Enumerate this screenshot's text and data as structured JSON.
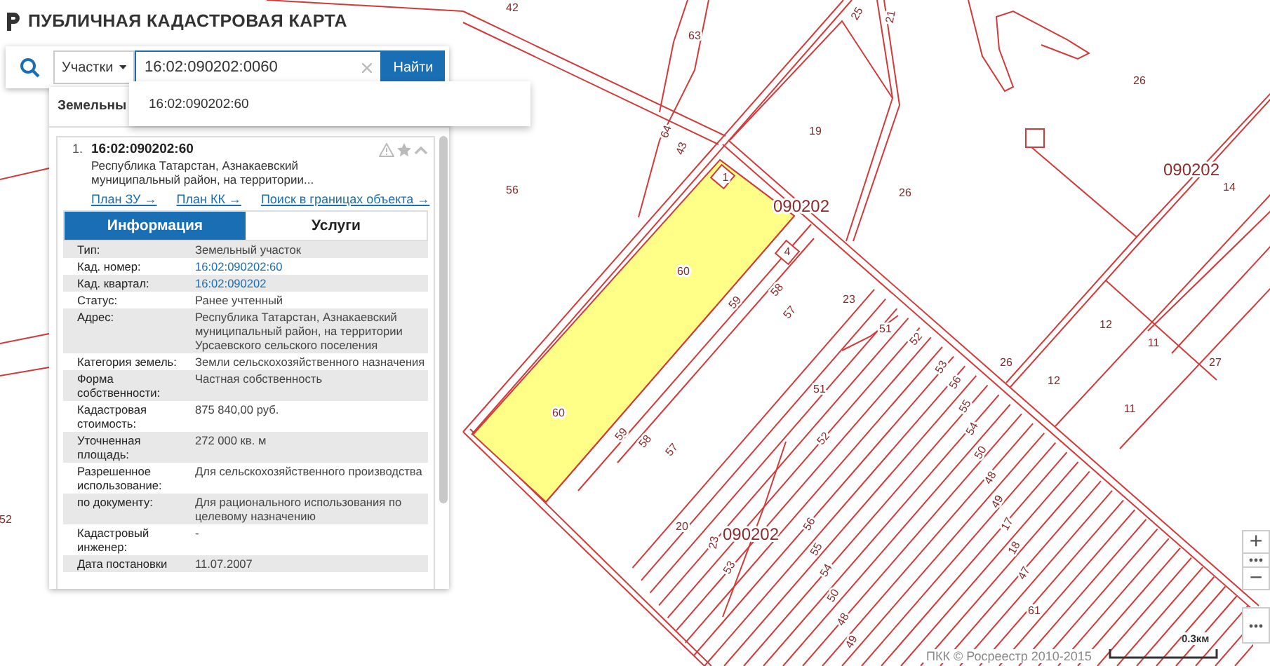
{
  "header": {
    "title": "ПУБЛИЧНАЯ КАДАСТРОВАЯ КАРТА"
  },
  "search": {
    "category": "Участки",
    "value": "16:02:090202:0060",
    "button": "Найти",
    "suggestions": [
      "16:02:090202:60"
    ]
  },
  "panel": {
    "title": "Земельны",
    "results": [
      {
        "number": "1.",
        "title": "16:02:090202:60",
        "address": "Республика Татарстан, Азнакаевский муниципальный район, на территории...",
        "links": [
          "План ЗУ →",
          "План КК →",
          "Поиск в границах объекта →"
        ],
        "tabs": [
          {
            "label": "Информация",
            "selected": true
          },
          {
            "label": "Услуги",
            "selected": false
          }
        ],
        "attributes": [
          {
            "label": "Тип:",
            "value": "Земельный участок",
            "kind": "text"
          },
          {
            "label": "Кад. номер:",
            "value": "16:02:090202:60",
            "kind": "link"
          },
          {
            "label": "Кад. квартал:",
            "value": "16:02:090202",
            "kind": "link"
          },
          {
            "label": "Статус:",
            "value": "Ранее учтенный",
            "kind": "text"
          },
          {
            "label": "Адрес:",
            "value": "Республика Татарстан, Азнакаевский муниципальный район, на территории Урсаевского сельского поселения",
            "kind": "text"
          },
          {
            "label": "Категория земель:",
            "value": "Земли сельскохозяйственного назначения",
            "kind": "text"
          },
          {
            "label": "Форма собственности:",
            "value": "Частная собственность",
            "kind": "text"
          },
          {
            "label": "Кадастровая стоимость:",
            "value": "875 840,00 руб.",
            "kind": "text"
          },
          {
            "label": "Уточненная площадь:",
            "value": "272 000 кв. м",
            "kind": "text"
          },
          {
            "label": "Разрешенное использование:",
            "value": "Для сельскохозяйственного производства",
            "kind": "text"
          },
          {
            "label": "по документу:",
            "value": "Для рационального использования по целевому назначению",
            "kind": "text"
          },
          {
            "label": "Кадастровый инженер:",
            "value": "-",
            "kind": "text"
          },
          {
            "label": "Дата постановки",
            "value": "11.07.2007",
            "kind": "text"
          }
        ]
      }
    ]
  },
  "map": {
    "labels": [
      {
        "text": "42",
        "kind": "parcel"
      },
      {
        "text": "63",
        "kind": "parcel"
      },
      {
        "text": "25",
        "kind": "parcel"
      },
      {
        "text": "21",
        "kind": "parcel"
      },
      {
        "text": "19",
        "kind": "parcel"
      },
      {
        "text": "26",
        "kind": "parcel"
      },
      {
        "text": "64",
        "kind": "parcel"
      },
      {
        "text": "43",
        "kind": "parcel"
      },
      {
        "text": "56",
        "kind": "parcel"
      },
      {
        "text": "1",
        "kind": "parcel"
      },
      {
        "text": "090202",
        "kind": "quarter"
      },
      {
        "text": "26",
        "kind": "parcel"
      },
      {
        "text": "090202",
        "kind": "quarter"
      },
      {
        "text": "14",
        "kind": "parcel"
      },
      {
        "text": "4",
        "kind": "parcel"
      },
      {
        "text": "60",
        "kind": "parcel"
      },
      {
        "text": "58",
        "kind": "parcel"
      },
      {
        "text": "59",
        "kind": "parcel"
      },
      {
        "text": "57",
        "kind": "parcel"
      },
      {
        "text": "23",
        "kind": "parcel"
      },
      {
        "text": "51",
        "kind": "parcel"
      },
      {
        "text": "52",
        "kind": "parcel"
      },
      {
        "text": "12",
        "kind": "parcel"
      },
      {
        "text": "11",
        "kind": "parcel"
      },
      {
        "text": "26",
        "kind": "parcel"
      },
      {
        "text": "27",
        "kind": "parcel"
      },
      {
        "text": "12",
        "kind": "parcel"
      },
      {
        "text": "11",
        "kind": "parcel"
      },
      {
        "text": "51",
        "kind": "parcel"
      },
      {
        "text": "60",
        "kind": "parcel"
      },
      {
        "text": "59",
        "kind": "parcel"
      },
      {
        "text": "58",
        "kind": "parcel"
      },
      {
        "text": "57",
        "kind": "parcel"
      },
      {
        "text": "52",
        "kind": "parcel"
      },
      {
        "text": "20",
        "kind": "parcel"
      },
      {
        "text": "090202",
        "kind": "quarter"
      },
      {
        "text": "61",
        "kind": "parcel"
      },
      {
        "text": "52",
        "kind": "parcel"
      },
      {
        "text": "53",
        "kind": "parcel"
      },
      {
        "text": "56",
        "kind": "parcel"
      },
      {
        "text": "55",
        "kind": "parcel"
      },
      {
        "text": "54",
        "kind": "parcel"
      },
      {
        "text": "50",
        "kind": "parcel"
      },
      {
        "text": "48",
        "kind": "parcel"
      },
      {
        "text": "49",
        "kind": "parcel"
      },
      {
        "text": "17",
        "kind": "parcel"
      },
      {
        "text": "18",
        "kind": "parcel"
      },
      {
        "text": "47",
        "kind": "parcel"
      },
      {
        "text": "23",
        "kind": "parcel"
      },
      {
        "text": "53",
        "kind": "parcel"
      },
      {
        "text": "56",
        "kind": "parcel"
      },
      {
        "text": "55",
        "kind": "parcel"
      },
      {
        "text": "54",
        "kind": "parcel"
      },
      {
        "text": "50",
        "kind": "parcel"
      },
      {
        "text": "48",
        "kind": "parcel"
      },
      {
        "text": "49",
        "kind": "parcel"
      }
    ],
    "attribution": "ПКК © Росреестр 2010-2015",
    "scale": "0.3км",
    "zoom_in": "+",
    "zoom_out": "−"
  }
}
